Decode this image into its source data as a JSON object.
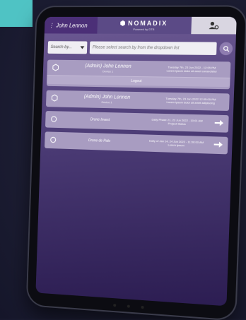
{
  "header": {
    "user_name": "John Lennon",
    "brand": "NOMADIX",
    "brand_sub": "Powered by DTB"
  },
  "search": {
    "select_value": "Search by...",
    "placeholder": "Please select search by from the dropdown list"
  },
  "sessions": [
    {
      "name": "(Admin) John Lennon",
      "sub": "Device 1",
      "meta1": "Tuesday 7th, 23 Jun 2022 - 12:05 PM",
      "meta2": "Lorem ipsum dolor sit amet consectetur",
      "action": "Logout"
    },
    {
      "name": "(Admin) John Lennon",
      "sub": "Device 1",
      "meta1": "Tuesday 7th, 23 Jun 2022 12:05:05 PM",
      "meta2": "Lorem ipsum dolor sit amet adipiscing"
    },
    {
      "name": "Drone Invest",
      "meta1": "Daily Phase 21, 23 Jun 2022 - 10:01 AM",
      "meta2": "Project Status"
    },
    {
      "name": "Drone de Palo",
      "meta1": "Daily of Jan 14, 24 Jun 2022 - 11:00:00 AM",
      "meta2": "Lorem ipsum"
    }
  ],
  "colors": {
    "accent_left": "#4fc3c4",
    "header_user": "#4b2f77",
    "header_logo": "#5b4a86",
    "card": "#a89cc1"
  }
}
